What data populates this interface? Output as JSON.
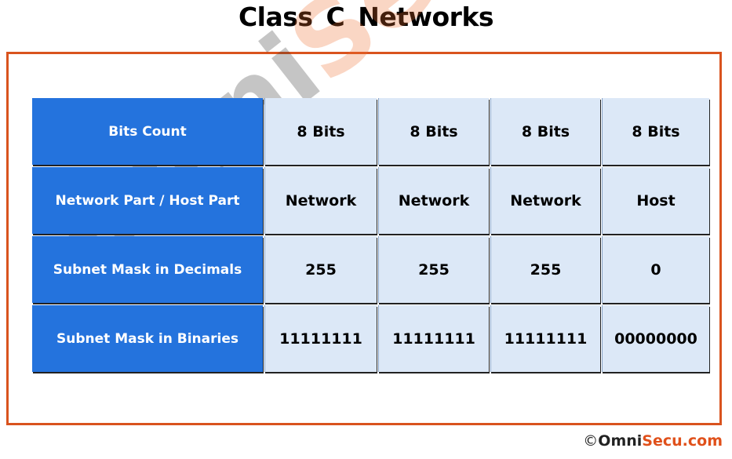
{
  "title": "Class C  Networks",
  "table": {
    "rows": [
      {
        "label": "Bits Count",
        "cells": [
          "8 Bits",
          "8 Bits",
          "8 Bits",
          "8 Bits"
        ]
      },
      {
        "label": "Network Part / Host Part",
        "cells": [
          "Network",
          "Network",
          "Network",
          "Host"
        ]
      },
      {
        "label": "Subnet Mask in Decimals",
        "cells": [
          "255",
          "255",
          "255",
          "0"
        ]
      },
      {
        "label": "Subnet Mask in Binaries",
        "cells": [
          "11111111",
          "11111111",
          "11111111",
          "00000000"
        ]
      }
    ]
  },
  "watermark": {
    "part1": "Omni",
    "part2": "Secu.com"
  },
  "footer": {
    "copyright_symbol": "©",
    "brand_part1": "Omni",
    "brand_part2": "Secu.com"
  },
  "colors": {
    "header_blue": "#2473dd",
    "cell_blue": "#dce8f7",
    "frame_orange": "#d9531e"
  }
}
